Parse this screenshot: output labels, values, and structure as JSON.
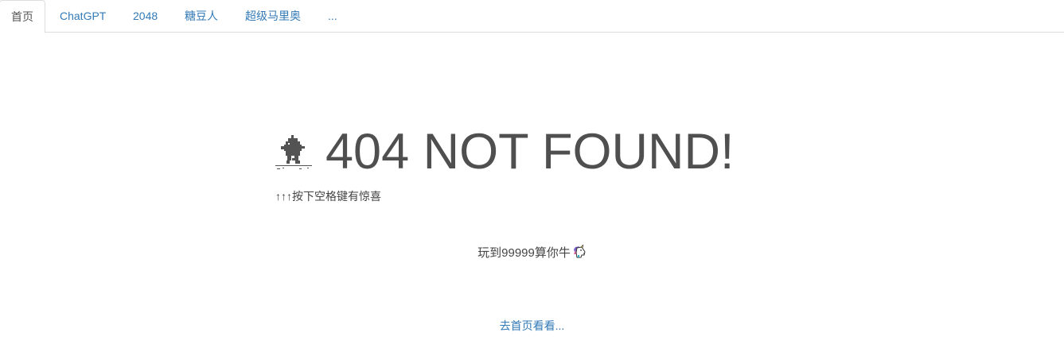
{
  "tabs": [
    {
      "label": "首页",
      "active": true
    },
    {
      "label": "ChatGPT",
      "active": false
    },
    {
      "label": "2048",
      "active": false
    },
    {
      "label": "糖豆人",
      "active": false
    },
    {
      "label": "超级马里奥",
      "active": false
    },
    {
      "label": "...",
      "active": false
    }
  ],
  "main": {
    "title": "404 NOT FOUND!",
    "hint": "↑↑↑按下空格键有惊喜",
    "challenge": "玩到99999算你牛",
    "home_link": "去首页看看..."
  },
  "icons": {
    "game_character": "pixel-dino-icon",
    "challenge_emoji": "unicorn-icon"
  },
  "colors": {
    "link": "#337ab7",
    "title": "#4f4f4f",
    "text": "#444444",
    "tab_border": "#dddddd"
  }
}
